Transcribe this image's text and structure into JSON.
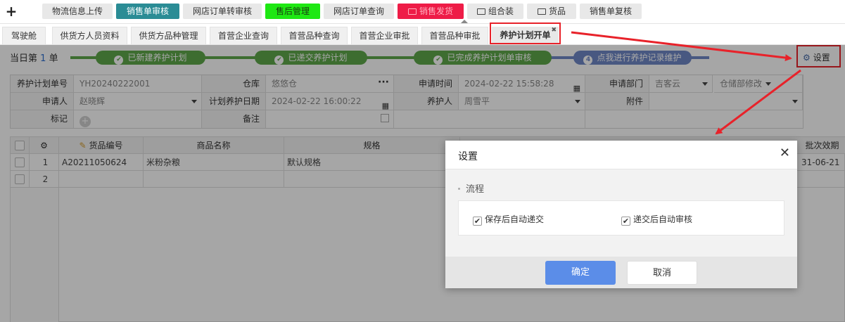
{
  "toolbar": {
    "plus": "+",
    "buttons": [
      {
        "label": "物流信息上传",
        "icon": ""
      },
      {
        "label": "销售单审核",
        "icon": ""
      },
      {
        "label": "网店订单转审核",
        "icon": ""
      },
      {
        "label": "售后管理",
        "icon": ""
      },
      {
        "label": "网店订单查询",
        "icon": ""
      },
      {
        "label": "销售发货",
        "icon": "folder-icon"
      },
      {
        "label": "组合装",
        "icon": "folder-icon"
      },
      {
        "label": "货品",
        "icon": "folder-icon"
      },
      {
        "label": "销售单复核",
        "icon": ""
      }
    ]
  },
  "tabs": [
    {
      "label": "驾驶舱"
    },
    {
      "label": "供货方人员资料"
    },
    {
      "label": "供货方品种管理"
    },
    {
      "label": "首营企业查询"
    },
    {
      "label": "首营品种查询"
    },
    {
      "label": "首营企业审批"
    },
    {
      "label": "首营品种审批"
    },
    {
      "label": "养护计划开单",
      "active": true,
      "close": "✖"
    }
  ],
  "progress": {
    "count_prefix": "当日第",
    "count_num": "1",
    "count_suffix": "单",
    "steps": [
      {
        "mark": "✔",
        "label": "已新建养护计划",
        "done": true
      },
      {
        "mark": "✔",
        "label": "已递交养护计划",
        "done": true
      },
      {
        "mark": "✔",
        "label": "已完成养护计划单审核",
        "done": true
      },
      {
        "mark": "4",
        "label": "点我进行养护记录维护",
        "done": false
      }
    ],
    "settings_label": "设置",
    "settings_icon": "gear-icon"
  },
  "form": {
    "plan_no_label": "养护计划单号",
    "plan_no": "YH20240222001",
    "warehouse_label": "仓库",
    "warehouse": "悠悠仓",
    "apply_time_label": "申请时间",
    "apply_time": "2024-02-22 15:58:28",
    "dept_label": "申请部门",
    "dept": "吉客云",
    "dept2": "仓储部修改",
    "applicant_label": "申请人",
    "applicant": "赵晓辉",
    "plan_date_label": "计划养护日期",
    "plan_date": "2024-02-22 16:00:22",
    "maintainer_label": "养护人",
    "maintainer": "周雪平",
    "attachment_label": "附件",
    "mark_label": "标记",
    "remark_label": "备注"
  },
  "grid": {
    "columns": [
      "货品编号",
      "商品名称",
      "规格",
      "批次效期"
    ],
    "rows": [
      {
        "no": "1",
        "code": "A20211050624",
        "name": "米粉杂粮",
        "spec": "默认规格",
        "expiry": "31-06-21"
      },
      {
        "no": "2",
        "code": "",
        "name": "",
        "spec": "",
        "expiry": ""
      }
    ]
  },
  "dialog": {
    "title": "设置",
    "close": "✕",
    "section": "流程",
    "options": [
      {
        "label": "保存后自动递交",
        "checked": true
      },
      {
        "label": "递交后自动审核",
        "checked": true
      }
    ],
    "ok": "确定",
    "cancel": "取消"
  },
  "colors": {
    "accent_green": "#5fa84b",
    "accent_blue": "#6f87c7",
    "primary_button": "#5b8de8",
    "annotation_red": "#e8222a"
  }
}
